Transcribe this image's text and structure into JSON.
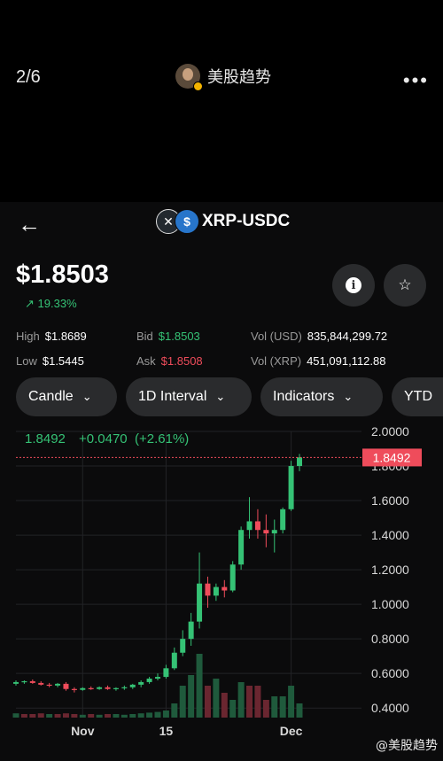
{
  "post": {
    "page_counter": "2/6",
    "author_name": "美股趋势",
    "more_icon": "more-horizontal-icon",
    "watermark": "@美股趋势"
  },
  "app": {
    "back_icon": "arrow-left-icon",
    "pair_name": "XRP-USDC",
    "price": "$1.8503",
    "change": "19.33%",
    "info_icon": "info-icon",
    "star_icon": "star-icon",
    "stats": {
      "high_label": "High",
      "high_value": "$1.8689",
      "low_label": "Low",
      "low_value": "$1.5445",
      "bid_label": "Bid",
      "bid_value": "$1.8503",
      "ask_label": "Ask",
      "ask_value": "$1.8508",
      "vol_usd_label": "Vol (USD)",
      "vol_usd_value": "835,844,299.72",
      "vol_xrp_label": "Vol (XRP)",
      "vol_xrp_value": "451,091,112.88"
    },
    "pills": [
      {
        "label": "Candle"
      },
      {
        "label": "1D Interval"
      },
      {
        "label": "Indicators"
      },
      {
        "label": "YTD"
      }
    ],
    "colors": {
      "up": "#35c275",
      "down": "#ef4c5b",
      "pill_bg": "#2a2b2d"
    }
  },
  "chart_data": {
    "type": "candlestick",
    "legend": {
      "close": "1.8492",
      "change": "+0.0470",
      "change_pct": "(+2.61%)"
    },
    "last_price_tag": "1.8492",
    "y_ticks": [
      "2.0000",
      "1.8000",
      "1.6000",
      "1.4000",
      "1.2000",
      "1.0000",
      "0.8000",
      "0.6000",
      "0.4000"
    ],
    "ylim": [
      0.36,
      2.0
    ],
    "x_ticks": [
      {
        "label": "Nov",
        "day": 8
      },
      {
        "label": "15",
        "day": 18
      },
      {
        "label": "Dec",
        "day": 33
      }
    ],
    "candles": [
      {
        "o": 0.54,
        "h": 0.56,
        "l": 0.53,
        "c": 0.55
      },
      {
        "o": 0.55,
        "h": 0.56,
        "l": 0.54,
        "c": 0.555
      },
      {
        "o": 0.555,
        "h": 0.565,
        "l": 0.54,
        "c": 0.545
      },
      {
        "o": 0.545,
        "h": 0.555,
        "l": 0.53,
        "c": 0.535
      },
      {
        "o": 0.535,
        "h": 0.545,
        "l": 0.52,
        "c": 0.53
      },
      {
        "o": 0.53,
        "h": 0.545,
        "l": 0.52,
        "c": 0.54
      },
      {
        "o": 0.54,
        "h": 0.55,
        "l": 0.5,
        "c": 0.51
      },
      {
        "o": 0.51,
        "h": 0.52,
        "l": 0.49,
        "c": 0.505
      },
      {
        "o": 0.505,
        "h": 0.52,
        "l": 0.5,
        "c": 0.515
      },
      {
        "o": 0.515,
        "h": 0.525,
        "l": 0.505,
        "c": 0.51
      },
      {
        "o": 0.51,
        "h": 0.525,
        "l": 0.505,
        "c": 0.52
      },
      {
        "o": 0.52,
        "h": 0.53,
        "l": 0.505,
        "c": 0.51
      },
      {
        "o": 0.51,
        "h": 0.52,
        "l": 0.5,
        "c": 0.515
      },
      {
        "o": 0.515,
        "h": 0.53,
        "l": 0.505,
        "c": 0.52
      },
      {
        "o": 0.52,
        "h": 0.54,
        "l": 0.51,
        "c": 0.535
      },
      {
        "o": 0.535,
        "h": 0.56,
        "l": 0.52,
        "c": 0.55
      },
      {
        "o": 0.55,
        "h": 0.58,
        "l": 0.54,
        "c": 0.57
      },
      {
        "o": 0.57,
        "h": 0.6,
        "l": 0.56,
        "c": 0.58
      },
      {
        "o": 0.58,
        "h": 0.65,
        "l": 0.57,
        "c": 0.63
      },
      {
        "o": 0.63,
        "h": 0.75,
        "l": 0.62,
        "c": 0.72
      },
      {
        "o": 0.72,
        "h": 0.85,
        "l": 0.7,
        "c": 0.8
      },
      {
        "o": 0.8,
        "h": 0.95,
        "l": 0.76,
        "c": 0.9
      },
      {
        "o": 0.9,
        "h": 1.3,
        "l": 0.86,
        "c": 1.12
      },
      {
        "o": 1.12,
        "h": 1.16,
        "l": 0.98,
        "c": 1.05
      },
      {
        "o": 1.05,
        "h": 1.12,
        "l": 1.02,
        "c": 1.1
      },
      {
        "o": 1.1,
        "h": 1.14,
        "l": 1.04,
        "c": 1.08
      },
      {
        "o": 1.08,
        "h": 1.25,
        "l": 1.07,
        "c": 1.23
      },
      {
        "o": 1.23,
        "h": 1.45,
        "l": 1.2,
        "c": 1.43
      },
      {
        "o": 1.43,
        "h": 1.62,
        "l": 1.38,
        "c": 1.48
      },
      {
        "o": 1.48,
        "h": 1.55,
        "l": 1.38,
        "c": 1.43
      },
      {
        "o": 1.43,
        "h": 1.52,
        "l": 1.33,
        "c": 1.41
      },
      {
        "o": 1.41,
        "h": 1.49,
        "l": 1.3,
        "c": 1.43
      },
      {
        "o": 1.43,
        "h": 1.56,
        "l": 1.41,
        "c": 1.55
      },
      {
        "o": 1.55,
        "h": 1.83,
        "l": 1.54,
        "c": 1.8
      },
      {
        "o": 1.8,
        "h": 1.87,
        "l": 1.77,
        "c": 1.85
      }
    ],
    "volumes": [
      0.06,
      0.05,
      0.05,
      0.06,
      0.05,
      0.05,
      0.06,
      0.05,
      0.04,
      0.05,
      0.04,
      0.05,
      0.05,
      0.04,
      0.05,
      0.06,
      0.07,
      0.08,
      0.1,
      0.2,
      0.45,
      0.6,
      0.9,
      0.45,
      0.55,
      0.35,
      0.25,
      0.5,
      0.45,
      0.45,
      0.25,
      0.3,
      0.3,
      0.45,
      0.2
    ],
    "volume_dir": [
      "g",
      "r",
      "r",
      "r",
      "g",
      "r",
      "r",
      "r",
      "g",
      "r",
      "g",
      "r",
      "g",
      "g",
      "g",
      "g",
      "g",
      "g",
      "g",
      "g",
      "g",
      "g",
      "g",
      "r",
      "g",
      "r",
      "g",
      "g",
      "r",
      "r",
      "r",
      "g",
      "g",
      "g",
      "g"
    ]
  }
}
